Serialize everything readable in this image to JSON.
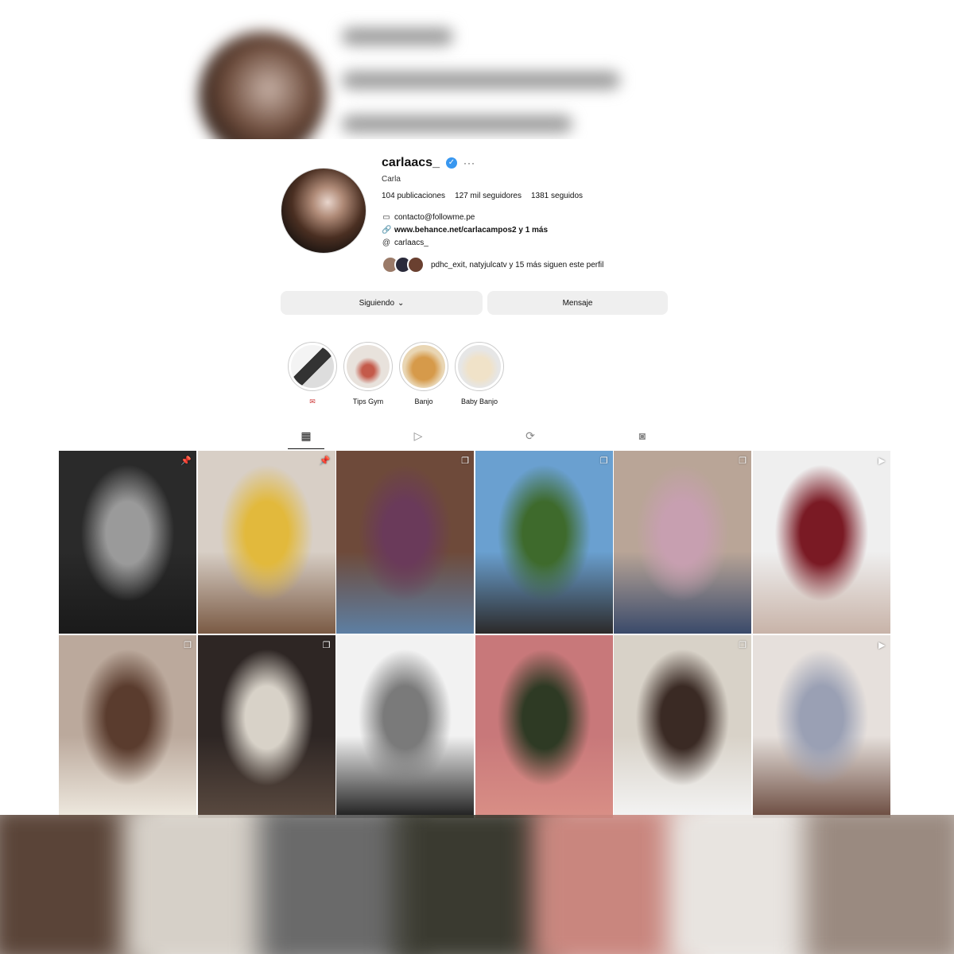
{
  "profile": {
    "username": "carlaacs_",
    "full_name": "Carla",
    "verified": true,
    "stats": {
      "posts": "104 publicaciones",
      "followers": "127 mil seguidores",
      "following": "1381 seguidos"
    },
    "contact_email": "contacto@followme.pe",
    "link": "www.behance.net/carlacampos2 y 1 más",
    "threads_handle": "carlaacs_",
    "followed_by": "pdhc_exit, natyjulcatv y 15 más siguen este perfil"
  },
  "actions": {
    "following_label": "Siguiendo",
    "message_label": "Mensaje"
  },
  "highlights": [
    {
      "label": "",
      "icon": "heart-envelope-icon"
    },
    {
      "label": "Tips Gym"
    },
    {
      "label": "Banjo"
    },
    {
      "label": "Baby Banjo"
    }
  ],
  "tabs": [
    "posts-grid-icon",
    "reels-icon",
    "reposts-icon",
    "tagged-icon"
  ],
  "posts": [
    {
      "badge": "pin-icon",
      "colors": [
        "#2a2a2a",
        "#9a9a9a",
        "#1a1a1a"
      ]
    },
    {
      "badge": "pin-icon",
      "colors": [
        "#d8cfc6",
        "#e2b93c",
        "#7a5a44"
      ]
    },
    {
      "badge": "carousel-icon",
      "colors": [
        "#6e4a3a",
        "#6a3a5a",
        "#5d7fa3"
      ]
    },
    {
      "badge": "carousel-icon",
      "colors": [
        "#6aa0d0",
        "#3e6a2c",
        "#2c2a2a"
      ]
    },
    {
      "badge": "carousel-icon",
      "colors": [
        "#b9a597",
        "#c79fb0",
        "#3a4a6a"
      ]
    },
    {
      "badge": "reel-icon",
      "colors": [
        "#efefef",
        "#7a1a24",
        "#c8b3a8"
      ]
    },
    {
      "badge": "carousel-icon",
      "colors": [
        "#bba99c",
        "#5a3c2e",
        "#efeae0"
      ]
    },
    {
      "badge": "carousel-icon",
      "colors": [
        "#2e2624",
        "#d8d2c8",
        "#5a4a40"
      ]
    },
    {
      "badge": "",
      "colors": [
        "#f2f2f2",
        "#7a7a7a",
        "#1d1d1d"
      ]
    },
    {
      "badge": "",
      "colors": [
        "#c8787a",
        "#2e3a24",
        "#d98f86"
      ]
    },
    {
      "badge": "carousel-icon",
      "colors": [
        "#d8d2c8",
        "#3a2a24",
        "#f4f4f4"
      ]
    },
    {
      "badge": "reel-icon",
      "colors": [
        "#e6e0dc",
        "#9aa0b4",
        "#6a4a3e"
      ]
    }
  ]
}
